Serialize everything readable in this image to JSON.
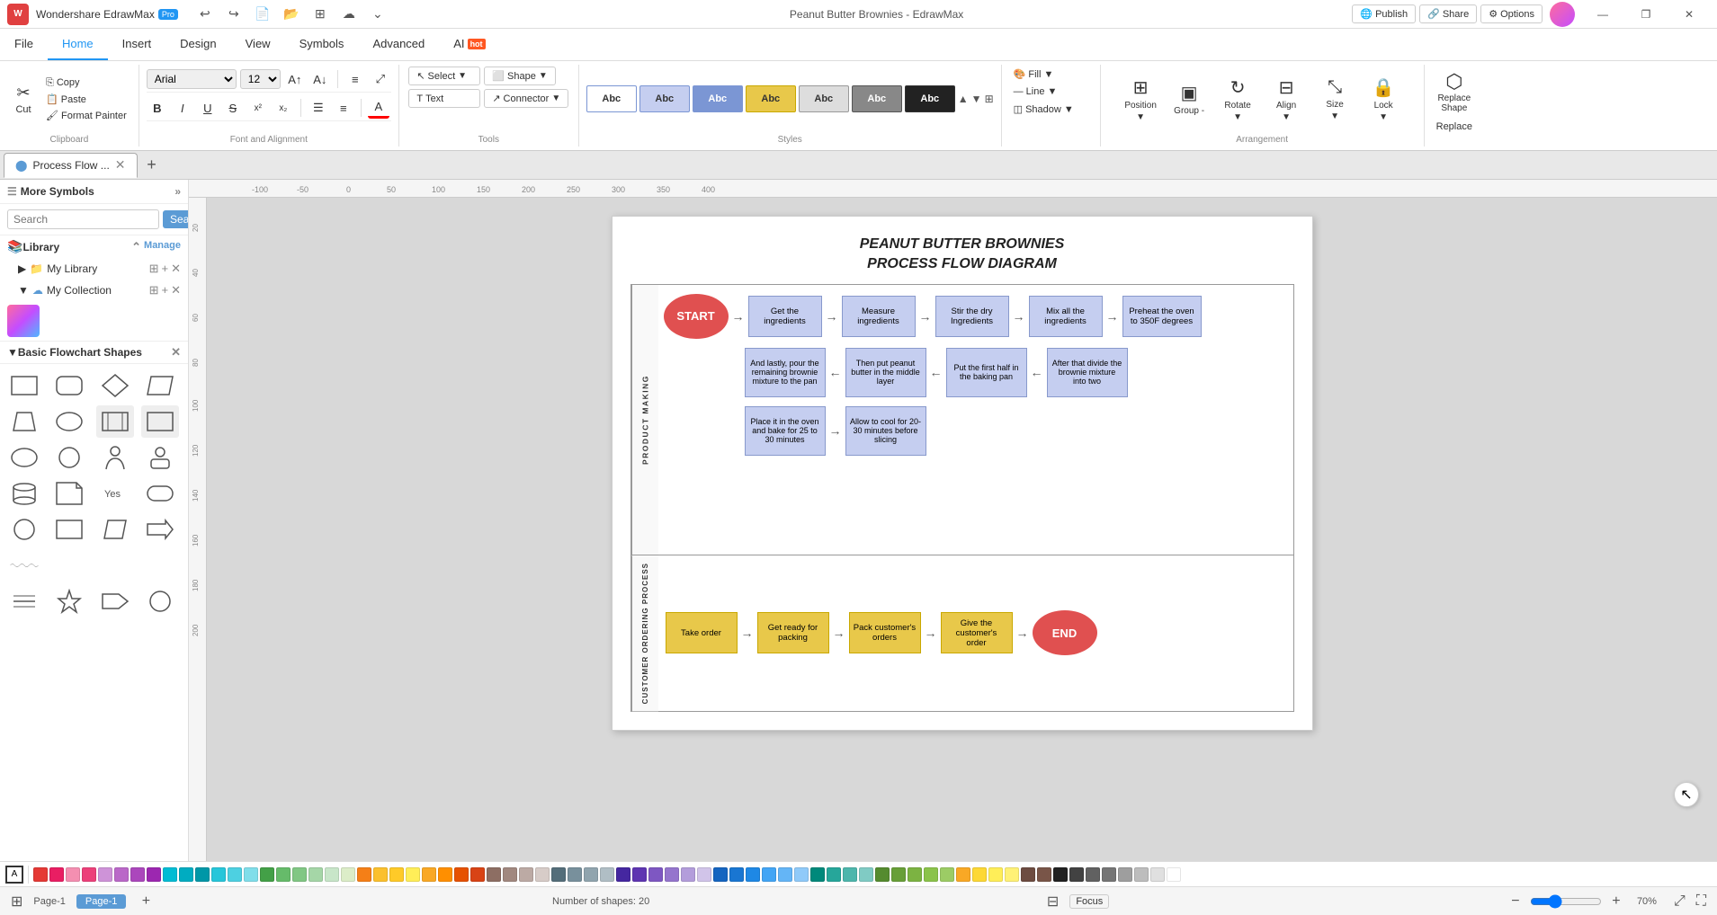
{
  "app": {
    "name": "Wondershare EdrawMax",
    "badge": "Pro",
    "title": "Peanut Butter Brownies - EdrawMax"
  },
  "titlebar": {
    "undo": "↩",
    "redo": "↪",
    "new": "📄",
    "open": "📂",
    "template": "⊞",
    "share_cloud": "☁",
    "more": "⌄",
    "minimize": "—",
    "restore": "❐",
    "close": "✕",
    "publish": "Publish",
    "share": "Share",
    "options": "Options"
  },
  "menu": {
    "items": [
      "File",
      "Home",
      "Insert",
      "Design",
      "View",
      "Symbols",
      "Advanced",
      "AI"
    ]
  },
  "ribbon": {
    "clipboard": {
      "label": "Clipboard",
      "cut": "✂",
      "copy": "⎘",
      "paste": "📋",
      "format_painter": "🖌"
    },
    "font": {
      "label": "Font and Alignment",
      "family": "Arial",
      "size": "12",
      "bold": "B",
      "italic": "I",
      "underline": "U",
      "strikethrough": "S",
      "superscript": "x²",
      "subscript": "x₂",
      "indent": "⇥",
      "bullets": "☰",
      "numbered": "≡",
      "align": "≡",
      "text_color": "A",
      "expand": "⤢"
    },
    "tools": {
      "label": "Tools",
      "select": "Select",
      "shape": "Shape",
      "text": "Text",
      "connector": "Connector"
    },
    "styles": {
      "label": "Styles",
      "items": [
        {
          "label": "Abc",
          "border": "#7b96d4",
          "bg": "white"
        },
        {
          "label": "Abc",
          "border": "#7b96d4",
          "bg": "#c5cef0"
        },
        {
          "label": "Abc",
          "border": "#7b96d4",
          "bg": "#7b96d4"
        },
        {
          "label": "Abc",
          "border": "#e0a030",
          "bg": "#e8c84a"
        },
        {
          "label": "Abc",
          "border": "#999",
          "bg": "#ddd"
        },
        {
          "label": "Abc",
          "border": "#555",
          "bg": "#888"
        },
        {
          "label": "Abc",
          "border": "#333",
          "bg": "#222"
        }
      ]
    },
    "format": {
      "label": "",
      "fill": "Fill ▼",
      "line": "Line ▼",
      "shadow": "Shadow ▼"
    },
    "position": {
      "label": "Arrangement",
      "position": "Position ▼",
      "group": "Group -",
      "rotate": "Rotate ▼",
      "align": "Align ▼",
      "size": "Size ▼",
      "lock": "Lock ▼"
    },
    "replace": {
      "replace_shape": "Replace Shape",
      "replace": "Replace"
    }
  },
  "tabs": {
    "items": [
      {
        "label": "Process Flow ...",
        "active": true
      }
    ],
    "add": "+"
  },
  "left_panel": {
    "header": "More Symbols",
    "search": {
      "placeholder": "Search",
      "button": "Search"
    },
    "library": {
      "label": "Library",
      "toggle": "⌃",
      "manage": "Manage"
    },
    "my_library": {
      "label": "My Library",
      "icon": "▶",
      "actions": [
        "⊞",
        "+",
        "✕"
      ]
    },
    "my_collection": {
      "label": "My Collection",
      "icon": "▼",
      "actions": [
        "⊞",
        "+",
        "✕"
      ]
    },
    "basic_shapes": {
      "label": "Basic Flowchart Shapes",
      "close": "✕"
    }
  },
  "diagram": {
    "title_line1": "PEANUT BUTTER BROWNIES",
    "title_line2": "PROCESS FLOW DIAGRAM",
    "swim_lanes": [
      {
        "label": "PRODUCT MAKING",
        "rows": [
          {
            "shapes": [
              {
                "type": "oval-red",
                "text": "START"
              },
              {
                "type": "arrow",
                "text": "→"
              },
              {
                "type": "rect-blue",
                "text": "Get the ingredients"
              },
              {
                "type": "arrow",
                "text": "→"
              },
              {
                "type": "rect-blue",
                "text": "Measure ingredients"
              },
              {
                "type": "arrow",
                "text": "→"
              },
              {
                "type": "rect-blue",
                "text": "Stir the dry Ingredients"
              },
              {
                "type": "arrow",
                "text": "→"
              },
              {
                "type": "rect-blue",
                "text": "Mix all the ingredients"
              },
              {
                "type": "arrow",
                "text": "→"
              },
              {
                "type": "rect-blue",
                "text": "Preheat the oven to 350F degrees"
              }
            ]
          },
          {
            "shapes": [
              {
                "type": "rect-blue",
                "text": "And lastly, pour the remaining brownie mixture to the pan"
              },
              {
                "type": "arrow",
                "text": "←"
              },
              {
                "type": "rect-blue",
                "text": "Then put peanut butter in the middle layer"
              },
              {
                "type": "arrow",
                "text": "←"
              },
              {
                "type": "rect-blue",
                "text": "Put the first half in the baking pan"
              },
              {
                "type": "arrow",
                "text": "←"
              },
              {
                "type": "rect-blue",
                "text": "After that divide the brownie mixture into two"
              }
            ]
          },
          {
            "shapes": [
              {
                "type": "rect-blue",
                "text": "Place it in the oven and bake for 25 to 30 minutes"
              },
              {
                "type": "arrow",
                "text": "→"
              },
              {
                "type": "rect-blue",
                "text": "Allow to cool for 20-30 minutes before slicing"
              }
            ]
          }
        ]
      },
      {
        "label": "CUSTOMER ORDERING PROCESS",
        "rows": [
          {
            "shapes": [
              {
                "type": "rect-yellow",
                "text": "Take order"
              },
              {
                "type": "arrow",
                "text": "→"
              },
              {
                "type": "rect-yellow",
                "text": "Get ready for packing"
              },
              {
                "type": "arrow",
                "text": "→"
              },
              {
                "type": "rect-yellow",
                "text": "Pack customer's orders"
              },
              {
                "type": "arrow",
                "text": "→"
              },
              {
                "type": "rect-yellow",
                "text": "Give the customer's order"
              },
              {
                "type": "arrow",
                "text": "→"
              },
              {
                "type": "oval-red",
                "text": "END"
              }
            ]
          }
        ]
      }
    ]
  },
  "statusbar": {
    "page_label": "Page-1",
    "page_tab": "Page-1",
    "shapes_count": "Number of shapes: 20",
    "focus": "Focus",
    "zoom_level": "70%",
    "zoom_minus": "−",
    "zoom_plus": "+"
  },
  "colorbar": {
    "colors": [
      "#e53935",
      "#e91e63",
      "#e91e63",
      "#f48fb1",
      "#ec407a",
      "#ce93d8",
      "#ba68c8",
      "#ab47bc",
      "#9c27b0",
      "#00bcd4",
      "#00acc1",
      "#0097a7",
      "#26c6da",
      "#4dd0e1",
      "#80deea",
      "#b2ebf2",
      "#43a047",
      "#66bb6a",
      "#81c784",
      "#a5d6a7",
      "#c8e6c9",
      "#dcedc8",
      "#f9fbe7",
      "#f57f17",
      "#fbc02d",
      "#ffca28",
      "#ffee58",
      "#f9a825",
      "#ff8f00",
      "#e65100",
      "#d84315",
      "#bf360c",
      "#8d6e63",
      "#a1887f",
      "#bcaaa4",
      "#d7ccc8",
      "#efebe9",
      "#546e7a",
      "#78909c",
      "#90a4ae",
      "#b0bec5",
      "#cfd8dc",
      "#eceff1",
      "#4527a0",
      "#5e35b1",
      "#7e57c2",
      "#9575cd",
      "#b39ddb",
      "#d1c4e9",
      "#1565c0",
      "#1976d2",
      "#1e88e5",
      "#42a5f5",
      "#64b5f6",
      "#90caf9",
      "#bbdefb",
      "#00897b",
      "#00acc1",
      "#26a69a",
      "#4db6ac",
      "#80cbc4",
      "#b2dfdb",
      "#e0f2f1",
      "#558b2f",
      "#689f38",
      "#7cb342",
      "#8bc34a",
      "#9ccc65",
      "#aed581",
      "#c5e1a5",
      "#f9a825",
      "#fdd835",
      "#ffee58",
      "#fff176",
      "#fff9c4",
      "#6d4c41",
      "#795548",
      "#8d6e63",
      "#a1887f",
      "#bcaaa4",
      "#37474f",
      "#455a64",
      "#546e7a",
      "#607d8b",
      "#78909c",
      "#90a4ae",
      "#212121",
      "#424242",
      "#616161",
      "#757575",
      "#9e9e9e",
      "#bdbdbd",
      "#e0e0e0",
      "#f5f5f5",
      "#ffffff"
    ]
  }
}
